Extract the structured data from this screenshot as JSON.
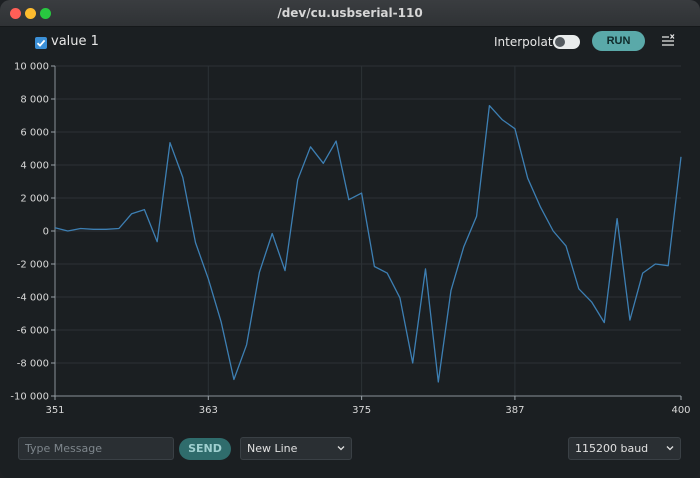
{
  "window": {
    "title": "/dev/cu.usbserial-110"
  },
  "toolbar": {
    "series_label": "value 1",
    "series_checked": true,
    "interpolate_label": "Interpolate",
    "interpolate_on": false,
    "run_label": "RUN"
  },
  "bottom": {
    "message_placeholder": "Type Message",
    "send_label": "SEND",
    "line_ending": "New Line",
    "baud": "115200 baud"
  },
  "colors": {
    "line": "#3d7fb3",
    "accent": "#5aa9a9",
    "grid": "#2c3236",
    "background": "#1b1f22"
  },
  "chart_data": {
    "type": "line",
    "series": [
      {
        "name": "value 1",
        "x": [
          351,
          352,
          353,
          354,
          355,
          356,
          357,
          358,
          359,
          360,
          361,
          362,
          363,
          364,
          365,
          366,
          367,
          368,
          369,
          370,
          371,
          372,
          373,
          374,
          375,
          376,
          377,
          378,
          379,
          380,
          381,
          382,
          383,
          384,
          385,
          386,
          387,
          388,
          389,
          390,
          391,
          392,
          393,
          394,
          395,
          396,
          397,
          398,
          399,
          400
        ],
        "y": [
          200,
          0,
          150,
          100,
          100,
          150,
          1050,
          1300,
          -650,
          5350,
          3250,
          -700,
          -2900,
          -5500,
          -9000,
          -6900,
          -2500,
          -150,
          -2400,
          3100,
          5100,
          4100,
          5450,
          1900,
          2300,
          -2150,
          -2550,
          -4050,
          -8000,
          -2300,
          -9150,
          -3600,
          -950,
          900,
          7600,
          6750,
          6200,
          3200,
          1450,
          0,
          -900,
          -3500,
          -4300,
          -5550,
          750,
          -5400,
          -2550,
          -2000,
          -2100,
          4500
        ]
      }
    ],
    "xlim": [
      351,
      400
    ],
    "ylim": [
      -10000,
      10000
    ],
    "x_ticks": [
      351,
      363,
      375,
      387,
      400
    ],
    "x_tick_labels": [
      "351",
      "363",
      "375",
      "387",
      "400"
    ],
    "y_ticks": [
      10000,
      8000,
      6000,
      4000,
      2000,
      0,
      -2000,
      -4000,
      -6000,
      -8000,
      -10000
    ],
    "y_tick_labels": [
      "10 000",
      "8 000",
      "6 000",
      "4 000",
      "2 000",
      "0",
      "-2 000",
      "-4 000",
      "-6 000",
      "-8 000",
      "-10 000"
    ],
    "grid": true
  }
}
